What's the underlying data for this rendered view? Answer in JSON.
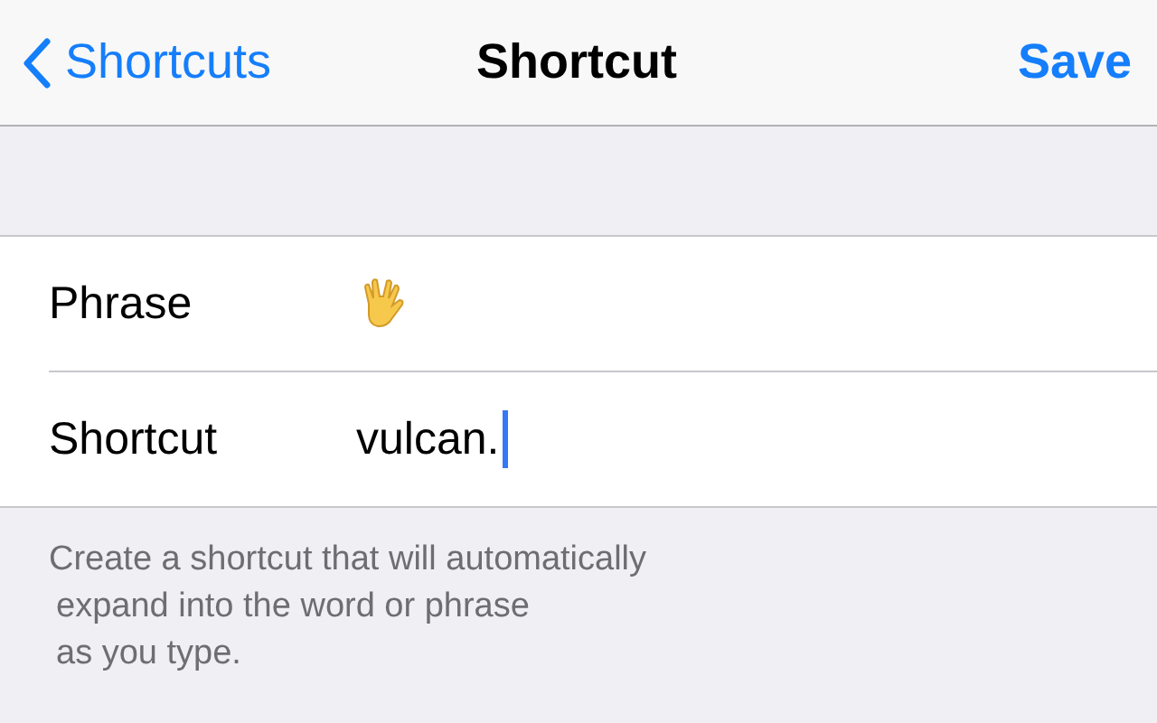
{
  "nav": {
    "back_label": "Shortcuts",
    "title": "Shortcut",
    "action": "Save"
  },
  "rows": [
    {
      "label": "Phrase",
      "kind": "emoji",
      "focused": false
    },
    {
      "label": "Shortcut",
      "kind": "text",
      "value": "vulcan.",
      "focused": true
    }
  ],
  "footer_lines": [
    "Create a shortcut that will automatically",
    "expand into the word or phrase",
    "as you type."
  ]
}
